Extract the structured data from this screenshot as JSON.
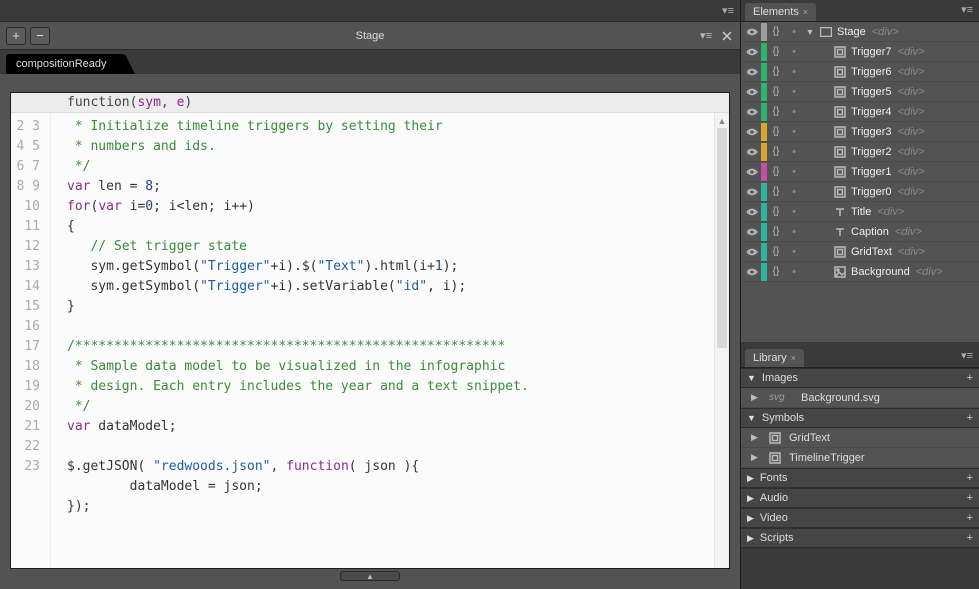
{
  "stage_label": "Stage",
  "event_tab": "compositionReady",
  "code": {
    "signature_pre": "function(",
    "signature_args": "sym, e",
    "signature_post": ")",
    "lines": [
      {
        "type": "cm",
        "text": " * Initialize timeline triggers by setting their"
      },
      {
        "type": "cm",
        "text": " * numbers and ids."
      },
      {
        "type": "cm",
        "text": " */"
      },
      {
        "type": "raw",
        "html": "<span class='kw'>var</span> len = <span class='num'>8</span>;"
      },
      {
        "type": "raw",
        "html": "<span class='kw'>for</span>(<span class='kw'>var</span> i=<span class='num'>0</span>; i&lt;len; i++)"
      },
      {
        "type": "raw",
        "html": "{"
      },
      {
        "type": "cm",
        "text": "   // Set trigger state"
      },
      {
        "type": "raw",
        "html": "   sym.getSymbol(<span class='str'>\"Trigger\"</span>+i).$(<span class='str'>\"Text\"</span>).html(i+<span class='num'>1</span>);"
      },
      {
        "type": "raw",
        "html": "   sym.getSymbol(<span class='str'>\"Trigger\"</span>+i).setVariable(<span class='str'>\"id\"</span>, i);"
      },
      {
        "type": "raw",
        "html": "}"
      },
      {
        "type": "raw",
        "html": ""
      },
      {
        "type": "cm",
        "text": "/*******************************************************"
      },
      {
        "type": "cm",
        "text": " * Sample data model to be visualized in the infographic"
      },
      {
        "type": "cm",
        "text": " * design. Each entry includes the year and a text snippet."
      },
      {
        "type": "cm",
        "text": " */"
      },
      {
        "type": "raw",
        "html": "<span class='kw'>var</span> dataModel;"
      },
      {
        "type": "raw",
        "html": ""
      },
      {
        "type": "raw",
        "html": "$.getJSON( <span class='str'>\"redwoods.json\"</span>, <span class='kw'>function</span>( json ){"
      },
      {
        "type": "raw",
        "html": "        dataModel = json;"
      },
      {
        "type": "raw",
        "html": "});"
      },
      {
        "type": "raw",
        "html": ""
      },
      {
        "type": "raw",
        "html": ""
      }
    ]
  },
  "elements_panel": {
    "title": "Elements",
    "root": {
      "name": "Stage",
      "tag": "<div>",
      "color": "#9c9c9c"
    },
    "items": [
      {
        "name": "Trigger7",
        "tag": "<div>",
        "color": "#2fb56a",
        "icon": "symbol"
      },
      {
        "name": "Trigger6",
        "tag": "<div>",
        "color": "#2fb56a",
        "icon": "symbol"
      },
      {
        "name": "Trigger5",
        "tag": "<div>",
        "color": "#2fb56a",
        "icon": "symbol"
      },
      {
        "name": "Trigger4",
        "tag": "<div>",
        "color": "#2fb56a",
        "icon": "symbol"
      },
      {
        "name": "Trigger3",
        "tag": "<div>",
        "color": "#d6a62f",
        "icon": "symbol"
      },
      {
        "name": "Trigger2",
        "tag": "<div>",
        "color": "#d6a62f",
        "icon": "symbol"
      },
      {
        "name": "Trigger1",
        "tag": "<div>",
        "color": "#c44fa8",
        "icon": "symbol"
      },
      {
        "name": "Trigger0",
        "tag": "<div>",
        "color": "#2fb5a1",
        "icon": "symbol"
      },
      {
        "name": "Title",
        "tag": "<div>",
        "color": "#2fb5a1",
        "icon": "text"
      },
      {
        "name": "Caption",
        "tag": "<div>",
        "color": "#2fb5a1",
        "icon": "text"
      },
      {
        "name": "GridText",
        "tag": "<div>",
        "color": "#2fb5a1",
        "icon": "symbol"
      },
      {
        "name": "Background",
        "tag": "<div>",
        "color": "#2fb5a1",
        "icon": "image"
      }
    ]
  },
  "library_panel": {
    "title": "Library",
    "sections": {
      "images": {
        "label": "Images",
        "items": [
          {
            "kind": "svg",
            "name": "Background.svg"
          }
        ]
      },
      "symbols": {
        "label": "Symbols",
        "items": [
          {
            "name": "GridText"
          },
          {
            "name": "TimelineTrigger"
          }
        ]
      },
      "fonts": {
        "label": "Fonts"
      },
      "audio": {
        "label": "Audio"
      },
      "video": {
        "label": "Video"
      },
      "scripts": {
        "label": "Scripts"
      }
    }
  }
}
